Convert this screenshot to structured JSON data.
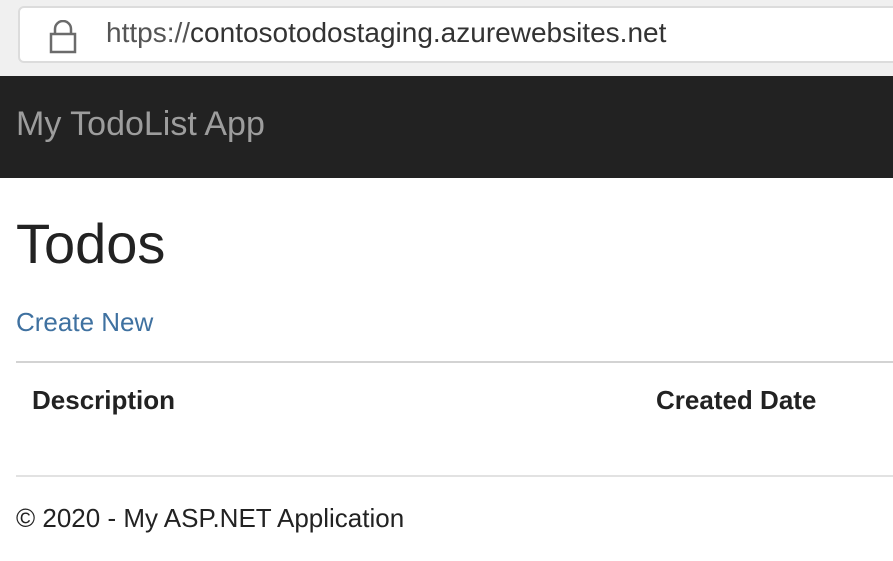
{
  "browser": {
    "url_scheme": "https://",
    "url_host": "contosotodostaging.azurewebsites.net",
    "lock_icon": "lock-icon"
  },
  "navbar": {
    "brand": "My TodoList App",
    "background": "#222222",
    "brand_color": "#9d9d9d"
  },
  "main": {
    "title": "Todos",
    "create_link": "Create New",
    "link_color": "#3f71a0",
    "table": {
      "headers": [
        "Description",
        "Created Date"
      ],
      "rows": []
    }
  },
  "footer": {
    "text": "© 2020 - My ASP.NET Application"
  }
}
